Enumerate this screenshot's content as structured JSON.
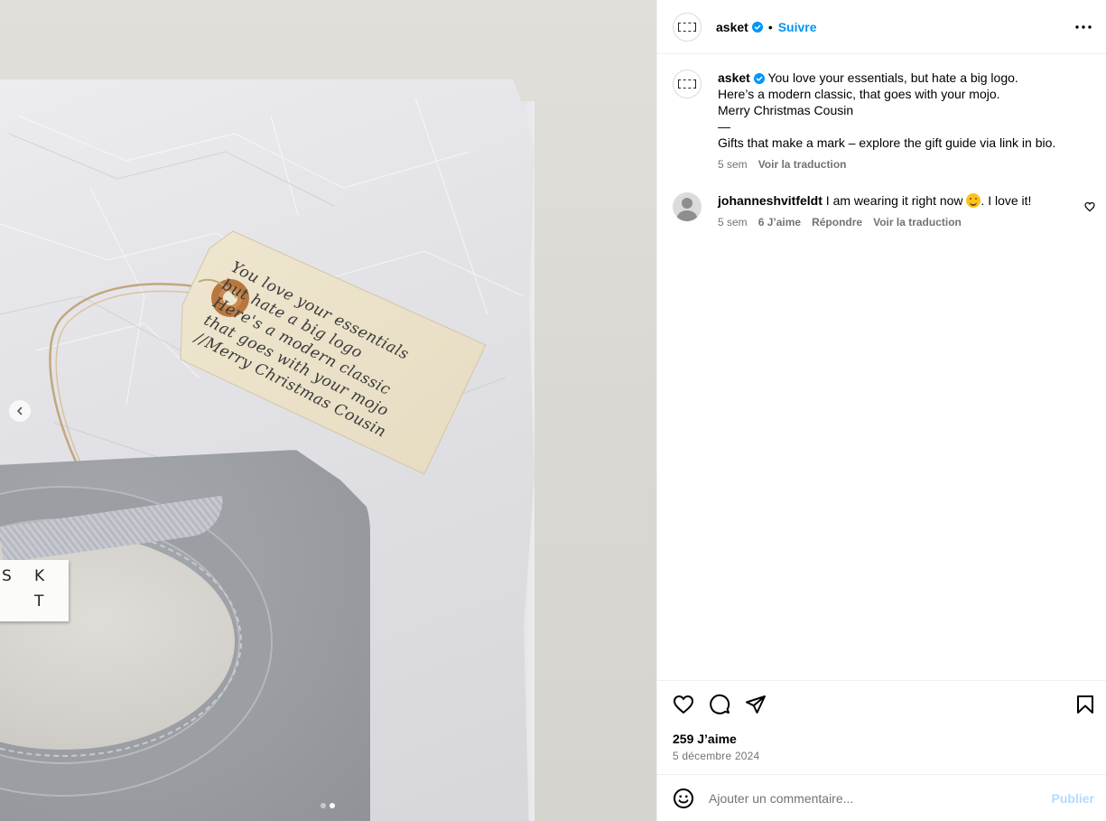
{
  "media": {
    "tag_lines": [
      "You love your essentials",
      "but hate a big logo",
      "Here's a modern classic",
      "that goes with your mojo",
      "//Merry Christmas Cousin"
    ],
    "label_letters": [
      "S",
      "K",
      "T"
    ],
    "carousel": {
      "count": 2,
      "active": 2
    }
  },
  "header": {
    "username": "asket",
    "separator": "•",
    "follow_label": "Suivre"
  },
  "caption": {
    "username": "asket",
    "lines": [
      "You love your essentials, but hate a big logo.",
      "Here’s a modern classic, that goes with your mojo.",
      "Merry Christmas Cousin",
      "—",
      "Gifts that make a mark – explore the gift guide via link in bio."
    ],
    "time": "5 sem",
    "translate": "Voir la traduction"
  },
  "comment": {
    "username": "johanneshvitfeldt",
    "text_before": "I am wearing it right now",
    "text_after": ". I love it!",
    "time": "5 sem",
    "likes": "6 J’aime",
    "reply": "Répondre",
    "translate": "Voir la traduction"
  },
  "footer": {
    "likes": "259 J’aime",
    "date": "5 décembre 2024"
  },
  "composer": {
    "placeholder": "Ajouter un commentaire...",
    "publish": "Publier"
  },
  "colors": {
    "accent": "#0095f6",
    "publish_disabled": "#b3dbff",
    "secondary_text": "#737373",
    "divider": "#efefef"
  }
}
